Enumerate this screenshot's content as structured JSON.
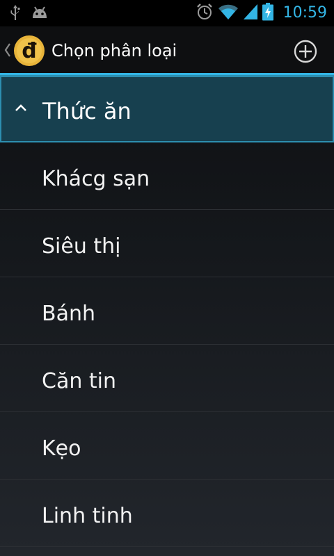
{
  "status_bar": {
    "time": "10:59",
    "icons": [
      "usb-icon",
      "android-debug-icon",
      "alarm-icon",
      "wifi-icon",
      "signal-icon",
      "battery-charging-icon"
    ]
  },
  "action_bar": {
    "logo_letter": "đ",
    "title": "Chọn phân loại",
    "icons": [
      "up-chevron-icon",
      "add-circle-icon"
    ]
  },
  "group": {
    "label": "Thức ăn",
    "expanded": true
  },
  "items": [
    {
      "label": "Khácg sạn"
    },
    {
      "label": "Siêu thị"
    },
    {
      "label": "Bánh"
    },
    {
      "label": "Căn tin"
    },
    {
      "label": "Kẹo"
    },
    {
      "label": "Linh tinh"
    }
  ],
  "colors": {
    "accent": "#33b5e5",
    "selected_bg": "#17404f",
    "logo": "#e8b43a"
  }
}
